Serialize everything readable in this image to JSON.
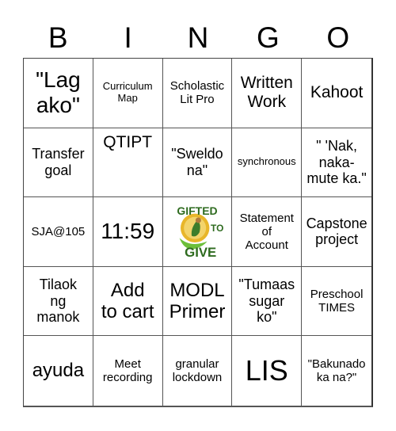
{
  "header": {
    "letters": [
      "B",
      "I",
      "N",
      "G",
      "O"
    ]
  },
  "cells": [
    [
      "\"Lag\nako\"",
      "Curriculum\nMap",
      "Scholastic\nLit Pro",
      "Written\nWork",
      "Kahoot"
    ],
    [
      "Transfer\ngoal",
      "QTIPT",
      "\"Sweldo\nna\"",
      "synchronous",
      "\" 'Nak,\nnaka-\nmute ka.\""
    ],
    [
      "SJA@105",
      "11:59",
      "",
      "Statement\nof\nAccount",
      "Capstone\nproject"
    ],
    [
      "Tilaok\nng\nmanok",
      "Add\nto cart",
      "MODL\nPrimer",
      "\"Tumaas\nsugar\nko\"",
      "Preschool\nTIMES"
    ],
    [
      "ayuda",
      "Meet\nrecording",
      "granular\nlockdown",
      "LIS",
      "\"Bakunado\nka na?\""
    ]
  ],
  "free_space": {
    "icon": "gifted-to-give-logo",
    "text_top": "GIFTED",
    "text_side": "TO",
    "text_bottom": "GIVE",
    "colors": {
      "green": "#2e6b1f",
      "light_green": "#6cbf3a",
      "gold": "#e8b62a"
    }
  }
}
